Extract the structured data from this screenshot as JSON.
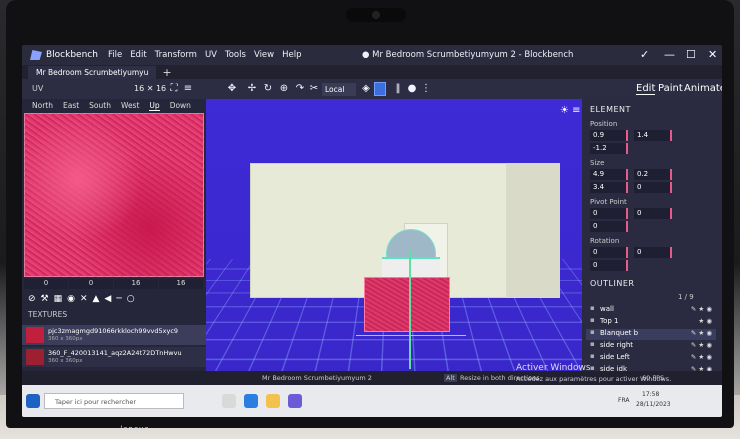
{
  "app": {
    "name": "Blockbench",
    "window_title": "● Mr Bedroom Scrumbetiyumyum 2 - Blockbench",
    "menu": [
      "File",
      "Edit",
      "Transform",
      "UV",
      "Tools",
      "View",
      "Help"
    ],
    "window_controls": [
      "✓",
      "—",
      "☐",
      "✕"
    ]
  },
  "tabs": [
    {
      "label": "Mr Bedroom Scrumbetiyumyu"
    }
  ],
  "toolbar": {
    "uv_label": "UV",
    "uv_size": "16 ✕ 16",
    "transform_space": "Local",
    "modes": [
      "Edit",
      "Paint",
      "Animate"
    ],
    "active_mode": "Edit"
  },
  "uv_panel": {
    "faces": [
      "North",
      "East",
      "South",
      "West",
      "Up",
      "Down"
    ],
    "active_face": "Up",
    "coords": [
      "0",
      "0",
      "16",
      "16"
    ],
    "textures_label": "TEXTURES",
    "textures": [
      {
        "name": "pjc3zmagmgd91066rkkloch99vvd5xyc9",
        "meta": "360 x 360px"
      },
      {
        "name": "360_F_420013141_aqz2A24t72DTnHwvu",
        "meta": "360 x 360px"
      }
    ]
  },
  "element_panel": {
    "title": "ELEMENT",
    "position_label": "Position",
    "position": [
      "0.9",
      "1.4",
      "-1.2"
    ],
    "size_label": "Size",
    "size": [
      "4.9",
      "0.2",
      "3.4",
      "0"
    ],
    "pivot_label": "Pivot Point",
    "pivot": [
      "0",
      "0",
      "0"
    ],
    "rotation_label": "Rotation",
    "rotation": [
      "0",
      "0",
      "0"
    ]
  },
  "outliner": {
    "title": "OUTLINER",
    "count": "1 / 9",
    "items": [
      {
        "name": "wall",
        "selected": false
      },
      {
        "name": "Top 1",
        "selected": false
      },
      {
        "name": "Blanquet b",
        "selected": true
      },
      {
        "name": "side right",
        "selected": false
      },
      {
        "name": "side Left",
        "selected": false
      },
      {
        "name": "side idk",
        "selected": false
      }
    ]
  },
  "status": {
    "file": "Mr Bedroom Scrumbetiyumyum 2",
    "hint_key": "Alt",
    "hint": "Resize in both directions",
    "fps": "60 FPS"
  },
  "watermark": {
    "title": "Activer Windows",
    "subtitle": "Accédez aux paramètres pour activer Windows."
  },
  "taskbar": {
    "search_placeholder": "Taper ici pour rechercher",
    "language": "FRA",
    "time": "17:58",
    "date": "28/11/2023"
  },
  "laptop_brand": "lenovo"
}
